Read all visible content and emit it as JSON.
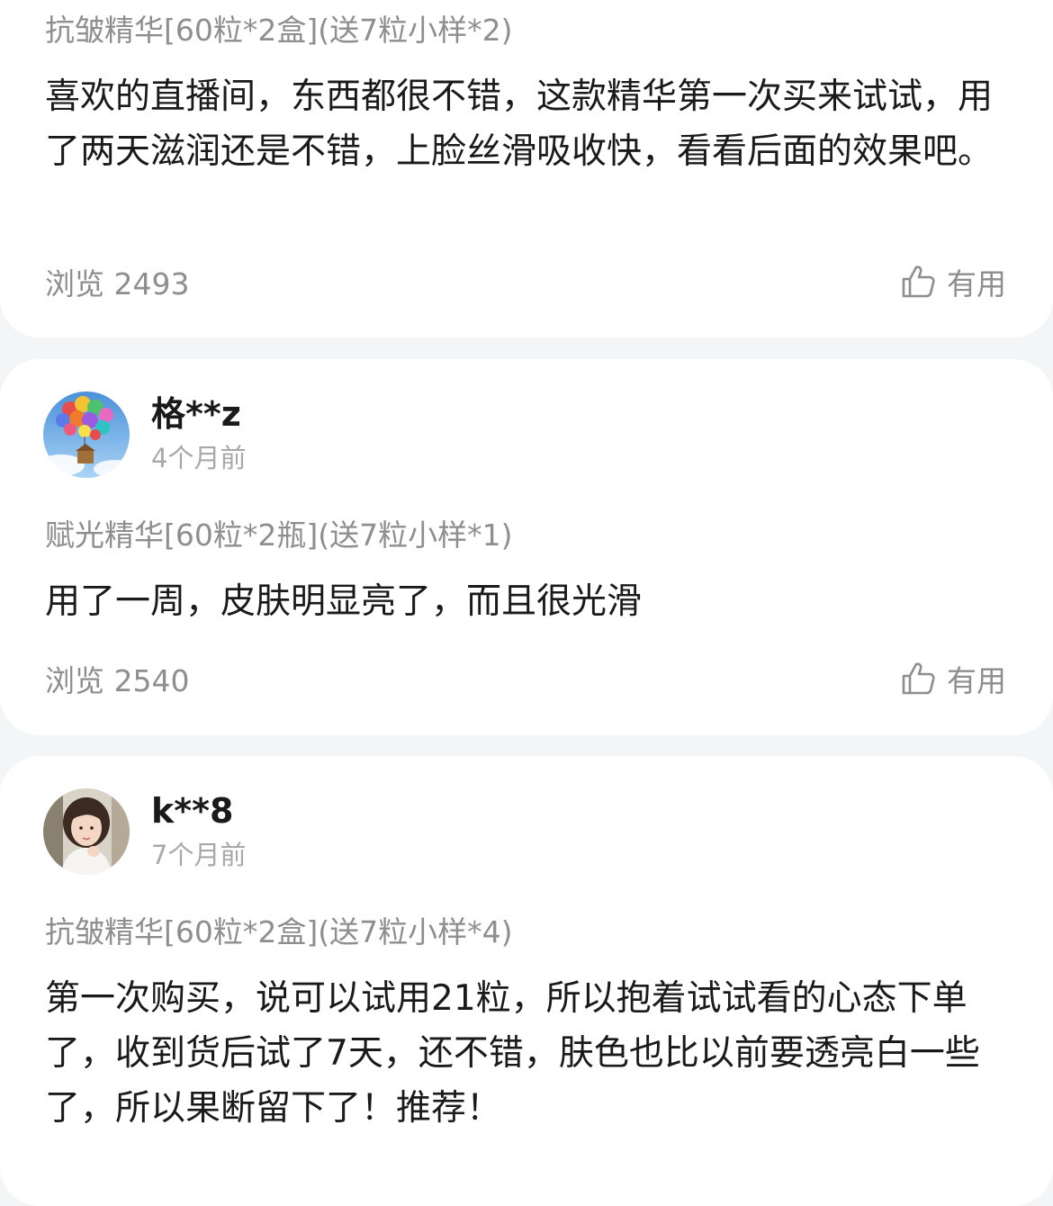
{
  "reviews": [
    {
      "sku": "抗皱精华[60粒*2盒](送7粒小样*2)",
      "content": "喜欢的直播间，东西都很不错，这款精华第一次买来试试，用了两天滋润还是不错，上脸丝滑吸收快，看看后面的效果吧。",
      "views": "浏览 2493",
      "useful": "有用"
    },
    {
      "username": "格**z",
      "time": "4个月前",
      "sku": "赋光精华[60粒*2瓶](送7粒小样*1)",
      "content": "用了一周，皮肤明显亮了，而且很光滑",
      "views": "浏览 2540",
      "useful": "有用"
    },
    {
      "username": "k**8",
      "time": "7个月前",
      "sku": "抗皱精华[60粒*2盒](送7粒小样*4)",
      "content": "第一次购买，说可以试用21粒，所以抱着试试看的心态下单了，收到货后试了7天，还不错，肤色也比以前要透亮白一些了，所以果断留下了！推荐！"
    }
  ],
  "icons": {
    "thumb": "thumbs-up-outline-icon"
  },
  "colors": {
    "background": "#f4f5f7",
    "card": "#ffffff",
    "text_primary": "#1a1a1a",
    "text_secondary": "#8e8e8e",
    "text_time": "#a8a8a8"
  }
}
